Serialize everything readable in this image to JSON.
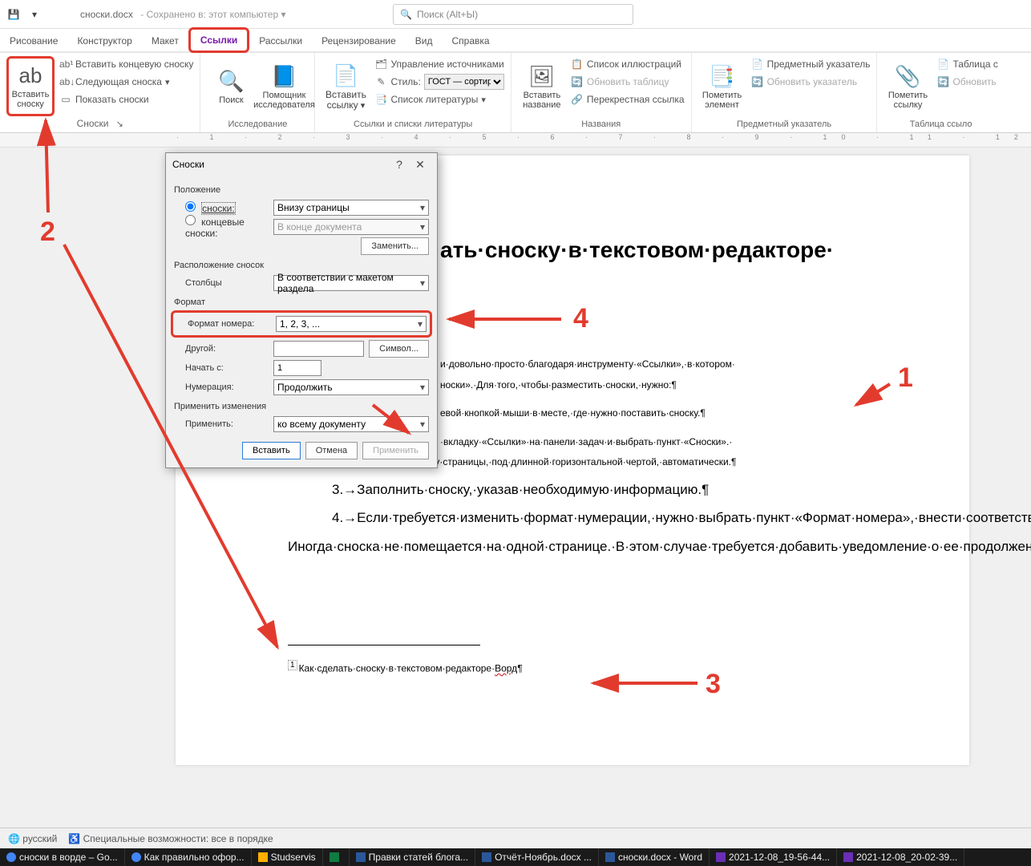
{
  "title": {
    "filename": "сноски.docx",
    "saved": "Сохранено в: этот компьютер",
    "search_ph": "Поиск (Alt+Ы)"
  },
  "tabs": [
    "Рисование",
    "Конструктор",
    "Макет",
    "Ссылки",
    "Рассылки",
    "Рецензирование",
    "Вид",
    "Справка"
  ],
  "active_tab": "Ссылки",
  "ribbon": {
    "footnotes": {
      "big": "Вставить сноску",
      "items": [
        "Вставить концевую сноску",
        "Следующая сноска",
        "Показать сноски"
      ],
      "label": "Сноски"
    },
    "research": {
      "find": "Поиск",
      "assistant": "Помощник исследователя",
      "label": "Исследование"
    },
    "citations": {
      "big": "Вставить ссылку",
      "manage": "Управление источниками",
      "style_lbl": "Стиль:",
      "style_val": "ГОСТ — сортиро",
      "biblio": "Список литературы",
      "label": "Ссылки и списки литературы"
    },
    "captions": {
      "big": "Вставить название",
      "list": "Список иллюстраций",
      "update": "Обновить таблицу",
      "cross": "Перекрестная ссылка",
      "label": "Названия"
    },
    "index": {
      "big": "Пометить элемент",
      "idx": "Предметный указатель",
      "update": "Обновить указатель",
      "label": "Предметный указатель"
    },
    "toa": {
      "big": "Пометить ссылку",
      "tbl": "Таблица с",
      "update": "Обновить",
      "label": "Таблица ссыло"
    }
  },
  "dialog": {
    "title": "Сноски",
    "sections": {
      "position": "Положение",
      "layout": "Расположение сносок",
      "format": "Формат",
      "apply": "Применить изменения"
    },
    "rows": {
      "footnotes": "сноски:",
      "footnotes_val": "Внизу страницы",
      "endnotes": "концевые сноски:",
      "endnotes_val": "В конце документа",
      "convert": "Заменить...",
      "columns": "Столбцы",
      "columns_val": "В соответствии с макетом раздела",
      "numfmt": "Формат номера:",
      "numfmt_val": "1, 2, 3, ...",
      "custom": "Другой:",
      "symbol": "Символ...",
      "start": "Начать с:",
      "start_val": "1",
      "numbering": "Нумерация:",
      "numbering_val": "Продолжить",
      "applyto": "Применить:",
      "applyto_val": "ко всему документу"
    },
    "buttons": {
      "insert": "Вставить",
      "cancel": "Отмена",
      "apply": "Применить"
    }
  },
  "doc": {
    "heading": "ать·сноску·в·текстовом·редакторе·",
    "p1": "и·довольно·просто·благодаря·инструменту·«Ссылки»,·в·котором·",
    "p1b": "носки».·Для·того,·чтобы·разместить·сноски,·нужно:¶",
    "li1": "евой·кнопкой·мыши·в·месте,·где·нужно·поставить·сноску.¶",
    "li2a": "·вкладку·«Ссылки»·на·панели·задач·и·выбрать·пункт·«Сноски».·",
    "li2b": "·установлена·внизу·страницы,·под·длинной·горизонтальной·чертой,·автоматически.¶",
    "li3": "3.→Заполнить·сноску,·указав·необходимую·информацию.¶",
    "li4": "4.→Если·требуется·изменить·формат·нумерации,·нужно·выбрать·пункт·«Формат·номера»,·внести·соответствующие·изменения·и·нажать·кнопку·«Применить».¶",
    "p2": "Иногда·сноска·не·помещается·на·одной·странице.·В·этом·случае·требуется·добавить·уведомление·о·ее·продолжении,·чтобы·проверяющий·и·читающий·диплом·понимал,·что·сноска·не·закончена.·Чтобы·сделать·это,·нужно:¶",
    "foot": "Как·сделать·сноску·в·текстовом·редакторе·",
    "foot_wavy": "Ворд",
    "foot_end": "¶",
    "foot_no": "1"
  },
  "annotations": {
    "n1": "1",
    "n2": "2",
    "n3": "3",
    "n4": "4"
  },
  "status": {
    "lang": "русский",
    "acc": "Специальные возможности: все в порядке"
  },
  "taskbar": [
    {
      "label": "сноски в ворде – Go..."
    },
    {
      "label": "Как правильно офор..."
    },
    {
      "label": "Studservis"
    },
    {
      "label": ""
    },
    {
      "label": "Правки статей блога..."
    },
    {
      "label": "Отчёт-Ноябрь.docx ..."
    },
    {
      "label": "сноски.docx - Word"
    },
    {
      "label": "2021-12-08_19-56-44..."
    },
    {
      "label": "2021-12-08_20-02-39..."
    }
  ]
}
